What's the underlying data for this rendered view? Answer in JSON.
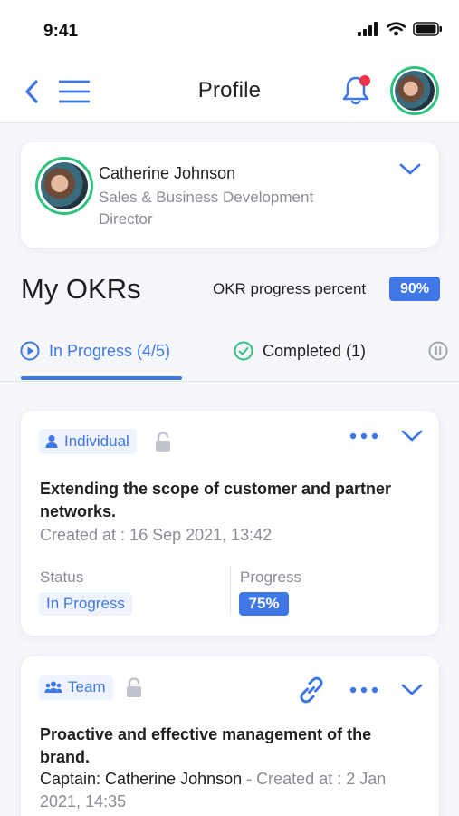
{
  "status_bar": {
    "time": "9:41"
  },
  "header": {
    "title": "Profile"
  },
  "profile": {
    "name": "Catherine Johnson",
    "role": "Sales & Business Development Director"
  },
  "okrs": {
    "heading": "My OKRs",
    "progress_label": "OKR progress percent",
    "progress_value": "90%",
    "progress_fraction": 0.9
  },
  "tabs": [
    {
      "label": "In Progress (4/5)",
      "active": true
    },
    {
      "label": "Completed (1)",
      "active": false
    }
  ],
  "cards": [
    {
      "type": "Individual",
      "title": "Extending the scope of customer and partner networks.",
      "created": "Created at : 16 Sep 2021, 13:42",
      "status_label": "Status",
      "status": "In Progress",
      "progress_label": "Progress",
      "progress": "75%"
    },
    {
      "type": "Team",
      "title": "Proactive and effective management of the brand.",
      "captain": "Captain: Catherine Johnson",
      "created": " - Created at : 2 Jan 2021, 14:35"
    }
  ],
  "colors": {
    "accent": "#3f78e6",
    "success": "#2ec27e",
    "notification": "#f0314a",
    "muted_text": "#8a8d96"
  },
  "icons": [
    "back-arrow-icon",
    "hamburger-menu-icon",
    "bell-icon",
    "chevron-down-icon",
    "play-circle-icon",
    "check-circle-icon",
    "pause-circle-icon",
    "person-icon",
    "team-icon",
    "lock-icon",
    "more-horizontal-icon",
    "link-icon"
  ]
}
